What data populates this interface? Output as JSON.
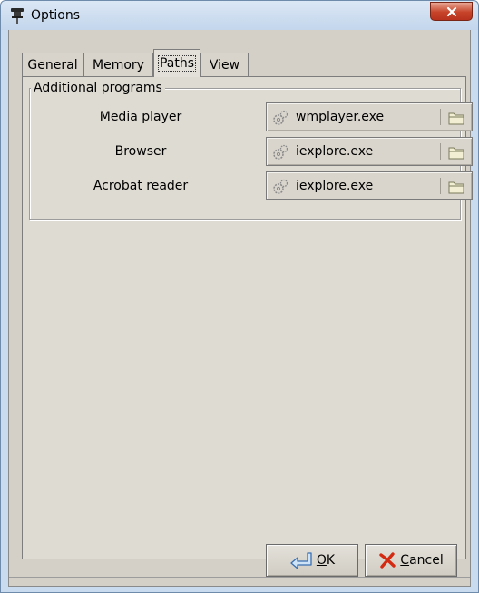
{
  "window": {
    "title": "Options"
  },
  "tabs": [
    {
      "label": "General",
      "active": false
    },
    {
      "label": "Memory",
      "active": false
    },
    {
      "label": "Paths",
      "active": true
    },
    {
      "label": "View",
      "active": false
    }
  ],
  "group": {
    "title": "Additional programs",
    "rows": [
      {
        "label": "Media player",
        "value": "wmplayer.exe"
      },
      {
        "label": "Browser",
        "value": "iexplore.exe"
      },
      {
        "label": "Acrobat reader",
        "value": "iexplore.exe"
      }
    ]
  },
  "buttons": {
    "ok": {
      "mnemonic": "O",
      "rest": "K"
    },
    "cancel": {
      "mnemonic": "C",
      "rest": "ancel"
    }
  },
  "colors": {
    "close_button": "#c7442a",
    "dialog_bg": "#d4d0c8",
    "titlebar": "#c9dcef"
  },
  "icons": {
    "app": "pushpin-icon",
    "close": "close-icon",
    "gear": "gear-icon",
    "folder": "folder-icon",
    "ok": "ok-arrow-icon",
    "cancel": "cancel-x-icon"
  }
}
